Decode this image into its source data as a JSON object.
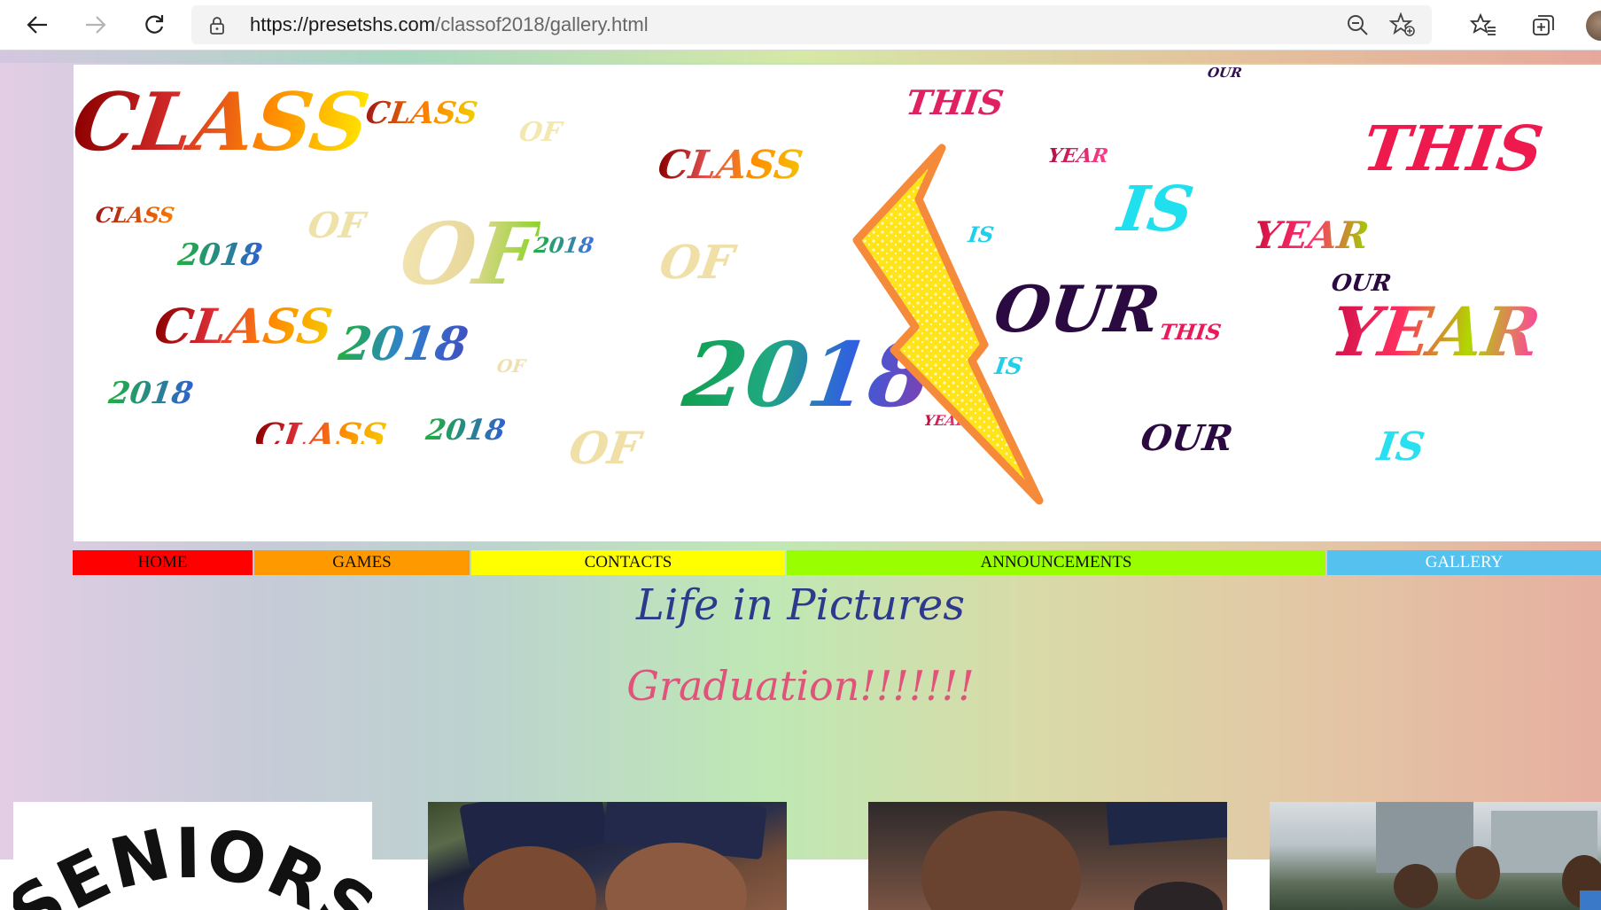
{
  "browser": {
    "url_host": "https://presetshs.com",
    "url_path": "/classof2018/gallery.html"
  },
  "icons": [
    "back-arrow-icon",
    "forward-arrow-icon",
    "refresh-icon",
    "lock-icon",
    "zoom-out-icon",
    "add-favorite-icon",
    "favorites-icon",
    "collections-icon",
    "profile-avatar"
  ],
  "banner": {
    "words": [
      "CLASS",
      "OF",
      "2018",
      "THIS",
      "IS",
      "OUR",
      "YEAR"
    ]
  },
  "menu": [
    {
      "label": "HOME",
      "color": "#ff0000"
    },
    {
      "label": "GAMES",
      "color": "#ff9900"
    },
    {
      "label": "CONTACTS",
      "color": "#ffff00"
    },
    {
      "label": "ANNOUNCEMENTS",
      "color": "#99ff00"
    },
    {
      "label": "GALLERY",
      "color": "#55c1ee"
    }
  ],
  "page": {
    "title": "Life in Pictures",
    "subtitle": "Graduation!!!!!!!"
  },
  "gallery": {
    "first_image_text": "SENIORS"
  },
  "colors": {
    "heading": "#2d3a8c",
    "subheading": "#e0537b"
  }
}
